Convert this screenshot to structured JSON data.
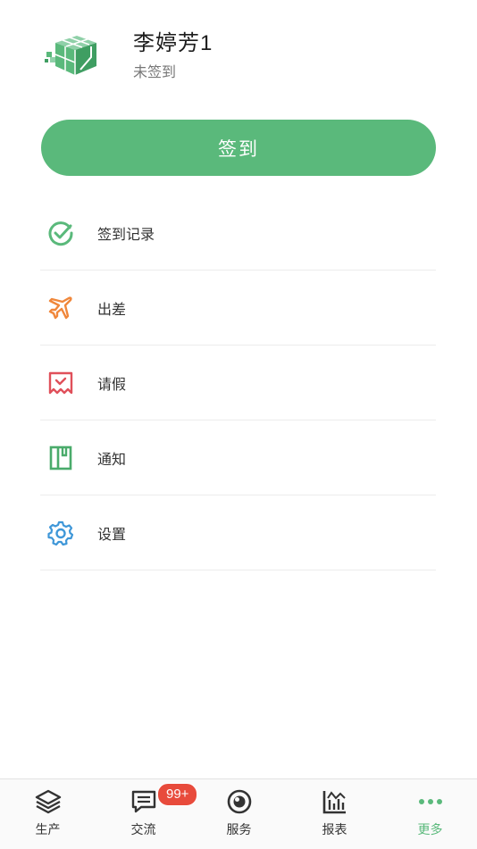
{
  "profile": {
    "name": "李婷芳1",
    "status": "未签到"
  },
  "checkin_button": {
    "label": "签到"
  },
  "menu": [
    {
      "label": "签到记录",
      "icon": "check-circle-icon",
      "color": "#5ab97b"
    },
    {
      "label": "出差",
      "icon": "airplane-icon",
      "color": "#f0873b"
    },
    {
      "label": "请假",
      "icon": "receipt-icon",
      "color": "#e0505a"
    },
    {
      "label": "通知",
      "icon": "bookmark-icon",
      "color": "#4aab6b"
    },
    {
      "label": "设置",
      "icon": "gear-icon",
      "color": "#3f97d8"
    }
  ],
  "tabbar": {
    "tabs": [
      {
        "label": "生产",
        "icon": "layers-icon"
      },
      {
        "label": "交流",
        "icon": "message-icon",
        "badge": "99+"
      },
      {
        "label": "服务",
        "icon": "service-icon"
      },
      {
        "label": "报表",
        "icon": "chart-icon"
      },
      {
        "label": "更多",
        "icon": "more-icon",
        "active": true
      }
    ],
    "active_color": "#5ab97b",
    "badge_color": "#e84b3c"
  }
}
